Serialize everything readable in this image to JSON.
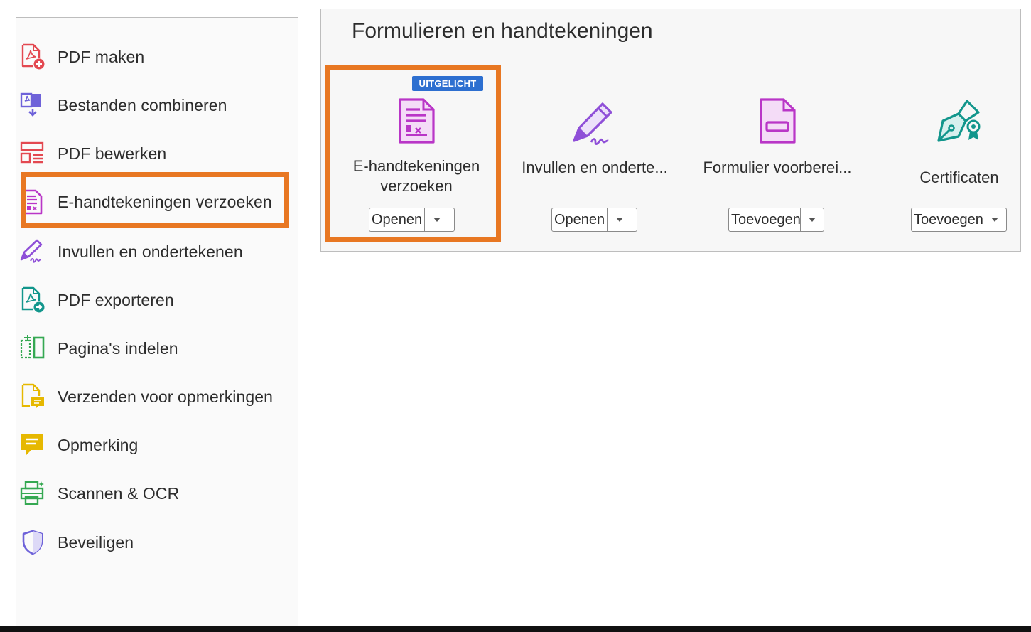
{
  "sidebar": {
    "items": [
      {
        "label": "PDF maken",
        "icon": "create-pdf-icon"
      },
      {
        "label": "Bestanden combineren",
        "icon": "combine-files-icon"
      },
      {
        "label": "PDF bewerken",
        "icon": "edit-pdf-icon"
      },
      {
        "label": "E-handtekeningen verzoeken",
        "icon": "request-esign-icon"
      },
      {
        "label": "Invullen en ondertekenen",
        "icon": "fill-sign-icon"
      },
      {
        "label": "PDF exporteren",
        "icon": "export-pdf-icon"
      },
      {
        "label": "Pagina's indelen",
        "icon": "organize-pages-icon"
      },
      {
        "label": "Verzenden voor opmerkingen",
        "icon": "send-for-comments-icon"
      },
      {
        "label": "Opmerking",
        "icon": "comment-icon"
      },
      {
        "label": "Scannen & OCR",
        "icon": "scan-ocr-icon"
      },
      {
        "label": "Beveiligen",
        "icon": "protect-icon"
      }
    ]
  },
  "panel": {
    "title": "Formulieren en handtekeningen",
    "tools": [
      {
        "label_line1": "E-handtekeningen",
        "label_line2": "verzoeken",
        "button": "Openen",
        "badge": "UITGELICHT",
        "icon": "request-esign-icon"
      },
      {
        "label_line1": "Invullen en onderte...",
        "button": "Openen",
        "icon": "fill-sign-icon"
      },
      {
        "label_line1": "Formulier voorberei...",
        "button": "Toevoegen",
        "icon": "prepare-form-icon"
      },
      {
        "label_line1": "Certificaten",
        "button": "Toevoegen",
        "icon": "certificates-icon"
      }
    ]
  },
  "colors": {
    "highlight": "#e87722",
    "badge": "#2d6fd0",
    "pdf_red": "#e34850",
    "purple": "#b936c7",
    "sign_purple": "#8f4fd8",
    "teal": "#12968c",
    "green": "#35a852",
    "yellow": "#e6b800",
    "blue_purple": "#6e62d9"
  }
}
